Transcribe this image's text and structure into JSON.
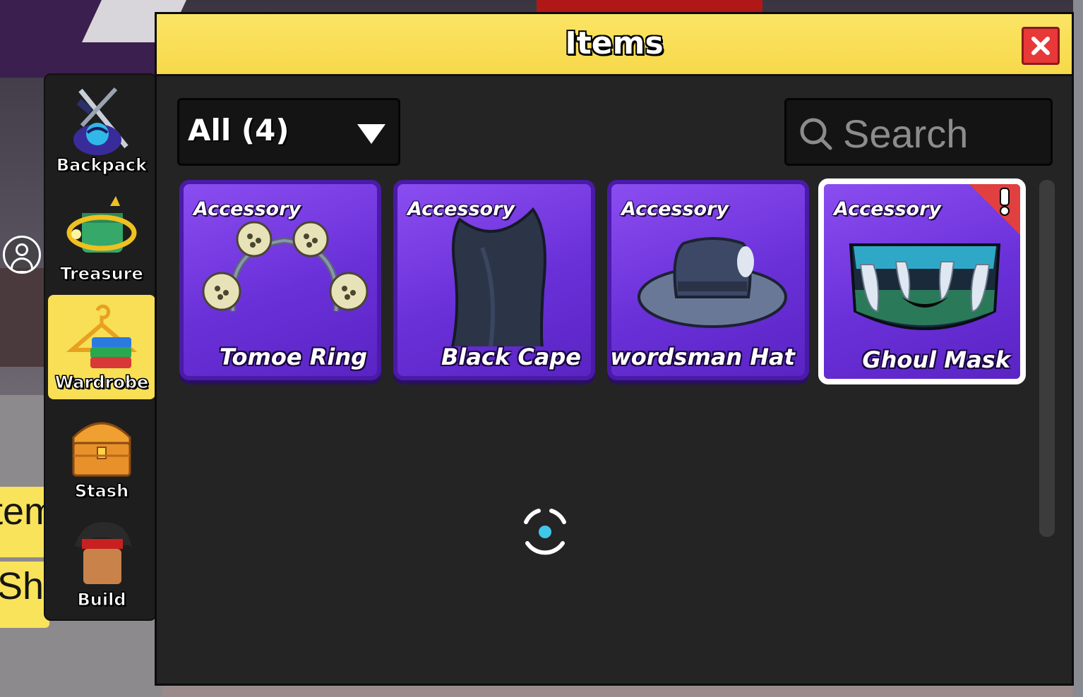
{
  "window": {
    "title": "Items"
  },
  "filter": {
    "value": "All (4)"
  },
  "search": {
    "placeholder": "Search"
  },
  "sidebar": {
    "items": [
      {
        "label": "Backpack",
        "icon": "backpack-icon"
      },
      {
        "label": "Treasure",
        "icon": "treasure-icon"
      },
      {
        "label": "Wardrobe",
        "icon": "wardrobe-icon",
        "active": true
      },
      {
        "label": "Stash",
        "icon": "stash-chest-icon"
      },
      {
        "label": "Build",
        "icon": "build-icon"
      }
    ]
  },
  "side_tabs": {
    "items_label": "Items",
    "shop_label": "Shop"
  },
  "items": [
    {
      "type": "Accessory",
      "name": "Tomoe Ring",
      "icon": "tomoe-ring-icon"
    },
    {
      "type": "Accessory",
      "name": "Black Cape",
      "icon": "black-cape-icon"
    },
    {
      "type": "Accessory",
      "name": "Swordsman Hat",
      "icon": "swordsman-hat-icon"
    },
    {
      "type": "Accessory",
      "name": "Ghoul Mask",
      "icon": "ghoul-mask-icon",
      "selected": true,
      "new": true
    }
  ],
  "colors": {
    "header": "#f8df56",
    "card": "#7a3ee8",
    "close": "#e83838",
    "panel": "#242424"
  }
}
